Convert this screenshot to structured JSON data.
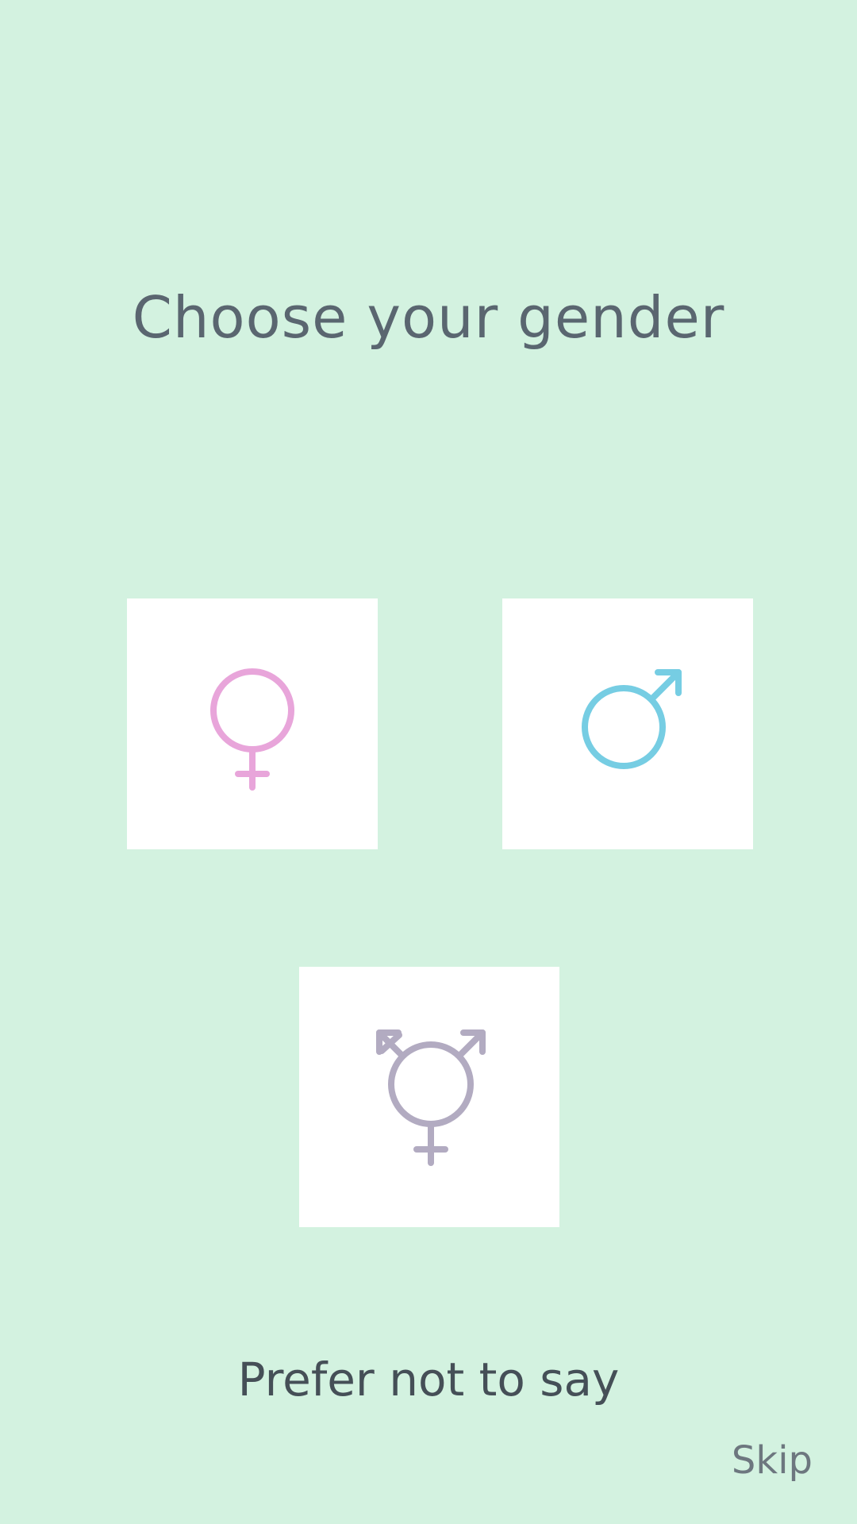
{
  "screen": {
    "title": "Choose your gender",
    "background_color": "#d3f2e0"
  },
  "options": {
    "female": {
      "icon": "female-symbol-icon",
      "color": "#e8a5da"
    },
    "male": {
      "icon": "male-symbol-icon",
      "color": "#76cde3"
    },
    "other": {
      "icon": "transgender-symbol-icon",
      "color": "#b2abc1"
    }
  },
  "prefer_not_to_say_label": "Prefer not to say",
  "skip_label": "Skip"
}
